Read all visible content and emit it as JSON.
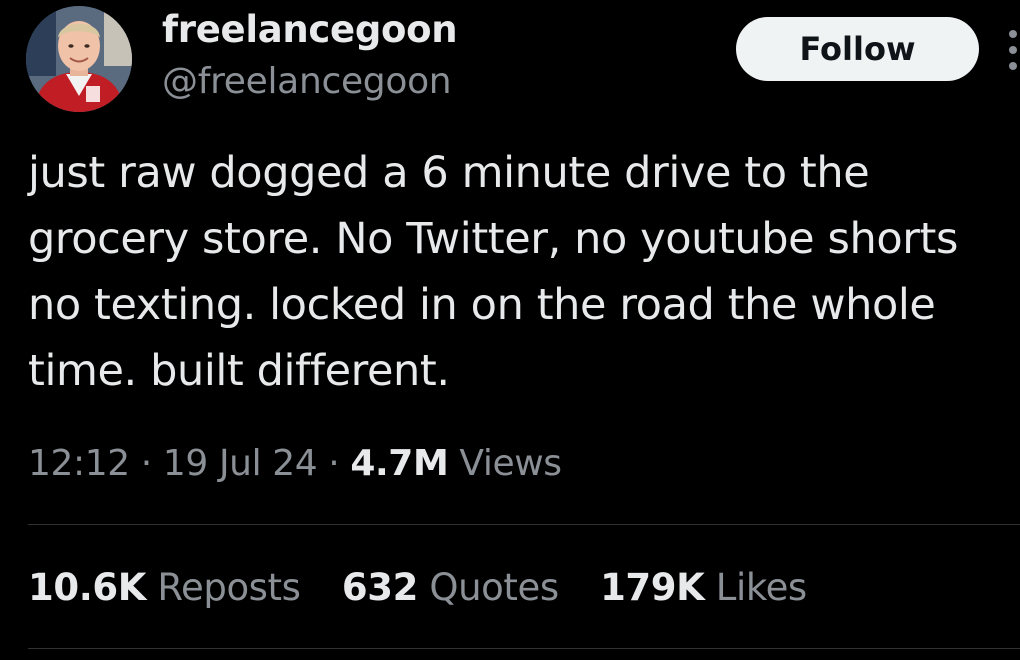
{
  "author": {
    "display_name": "freelancegoon",
    "handle": "@freelancegoon",
    "avatar_icon": "user-avatar-photo"
  },
  "follow_button": {
    "label": "Follow"
  },
  "more_icon": "more-options-icon",
  "tweet": {
    "lines": [
      "just raw dogged a 6 minute drive to the",
      "grocery store. No Twitter, no youtube shorts",
      "no texting. locked in on the road the whole",
      "time. built different."
    ]
  },
  "meta": {
    "time": "12:12",
    "separator": "·",
    "date": "19 Jul 24",
    "views_count": "4.7M",
    "views_label": "Views"
  },
  "stats": {
    "reposts_count": "10.6K",
    "reposts_label": "Reposts",
    "quotes_count": "632",
    "quotes_label": "Quotes",
    "likes_count": "179K",
    "likes_label": "Likes"
  },
  "colors": {
    "background": "#000000",
    "primary_text": "#e7e9ea",
    "secondary_text": "#8b9096",
    "follow_button_bg": "#eff3f4",
    "divider": "#2f3336"
  }
}
